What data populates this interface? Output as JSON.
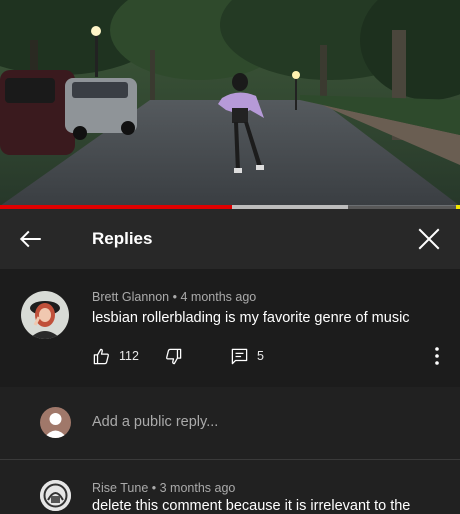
{
  "video": {
    "progress_played_percent": 50.5,
    "progress_buffered_percent": 75.7
  },
  "header": {
    "title": "Replies",
    "back_icon": "arrow-back-icon",
    "close_icon": "close-icon"
  },
  "comment": {
    "author": "Brett Glannon",
    "time": "4 months ago",
    "text": "lesbian rollerblading is my favorite genre of music",
    "likes": "112",
    "replies": "5"
  },
  "add_reply": {
    "placeholder": "Add a public reply..."
  },
  "reply": {
    "author": "Rise Tune",
    "time": "3 months ago",
    "text": "delete this comment because it is irrelevant to the"
  },
  "colors": {
    "progress_red": "#e00000",
    "background": "#212121"
  }
}
